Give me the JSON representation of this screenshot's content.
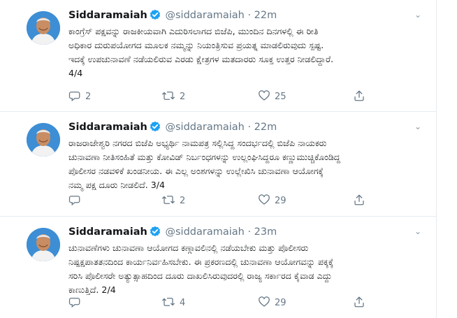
{
  "colors": {
    "accent": "#1da1f2",
    "text_primary": "#14171a",
    "text_secondary": "#657786",
    "divider": "#e6ecf0"
  },
  "tweets": [
    {
      "name": "Siddaramaiah",
      "handle": "@siddaramaiah",
      "dot": "·",
      "time": "22m",
      "text": "ಕಾಂಗ್ರೆಸ್ ಪಕ್ಷವನ್ನು ರಾಜಕೀಯವಾಗಿ ಎದುರಿಸಲಾಗದ ಬಿಜೆಪಿ, ಮುಂದಿನ ದಿನಗಳಲ್ಲಿ ಈ ರೀತಿ\nಅಧಿಕಾರ ದುರುಪಯೋಗದ ಮೂಲಕ ನಮ್ಮನ್ನು ನಿಯಂತ್ರಿಸುವ ಪ್ರಯತ್ನ ಮಾಡಲಿರುವುದು ಸ್ಪಷ್ಟ.\nಇದಕ್ಕೆ ಉಪಚುನಾವಣೆ ನಡೆಯಲಿರುವ ಎರಡು ಕ್ಷೇತ್ರಗಳ ಮತದಾರರು ಸೂಕ್ತ ಉತ್ತರ ನೀಡಲಿದ್ದಾರೆ.\n4/4",
      "replies": "2",
      "retweets": "2",
      "likes": "25",
      "icons": [
        "reply-icon",
        "retweet-icon",
        "like-icon",
        "share-icon"
      ]
    },
    {
      "name": "Siddaramaiah",
      "handle": "@siddaramaiah",
      "dot": "·",
      "time": "22m",
      "text": "ರಾಜರಾಜೇಶ್ವರಿ ನಗರದ ಬಿಜೆಪಿ ಅಭ್ಯರ್ಥಿ ನಾಮಪತ್ರ ಸಲ್ಲಿಸಿದ್ದ ಸಂದರ್ಭದಲ್ಲಿ ಬಿಜೆಪಿ ನಾಯಕರು\nಚುನಾವಣಾ ನೀತಿಸಂಹಿತೆ ಮತ್ತು ಕೋವಿಡ್ ನಿರ್ಬಂಧಗಳನ್ನು ಉಲ್ಲಂಘಿಸಿದ್ದರೂ ಕಣ್ಣುಮುಚ್ಚಿಕೊಂಡಿದ್ದ\nಪೊಲೀಸರ ನಡವಳಿಕೆ ಖಂಡನೀಯ. ಈ ಎಲ್ಲ ಅಂಶಗಳನ್ನು ಉಲ್ಲೇಖಿಸಿ ಚುನಾವಣಾ ಆಯೋಗಕ್ಕೆ\nನಮ್ಮ ಪಕ್ಷ ದೂರು ನೀಡಲಿದೆ. 3/4",
      "replies": "",
      "retweets": "2",
      "likes": "29"
    },
    {
      "name": "Siddaramaiah",
      "handle": "@siddaramaiah",
      "dot": "·",
      "time": "23m",
      "text": "ಚುನಾವಣೆಗಳು ಚುನಾವಣಾ ಆಯೋಗದ ಕಣ್ಗಾವಲಿನಲ್ಲಿ ನಡೆಯಬೇಕು ಮತ್ತು ಪೊಲೀಸರು\nನಿಷ್ಪಕ್ಷಪಾತತನದಿಂದ ಕಾರ್ಯನಿರ್ವಹಿಸಬೇಕು. ಈ ಪ್ರಕರಣದಲ್ಲಿ ಚುನಾವಣಾ ಆಯೋಗವನ್ನು ಪಕ್ಕಕ್ಕೆ\nಸರಿಸಿ ಪೊಲೀಸರೇ ಅತ್ಯುತ್ಸಾಹದಿಂದ ದೂರು ದಾಖಲಿಸಿರುವುದರಲ್ಲಿ ರಾಜ್ಯ ಸರ್ಕಾರದ ಕೈವಾಡ ಎದ್ದು\nಕಾಣುತ್ತಿದೆ. 2/4",
      "replies": "",
      "retweets": "4",
      "likes": "29"
    }
  ]
}
